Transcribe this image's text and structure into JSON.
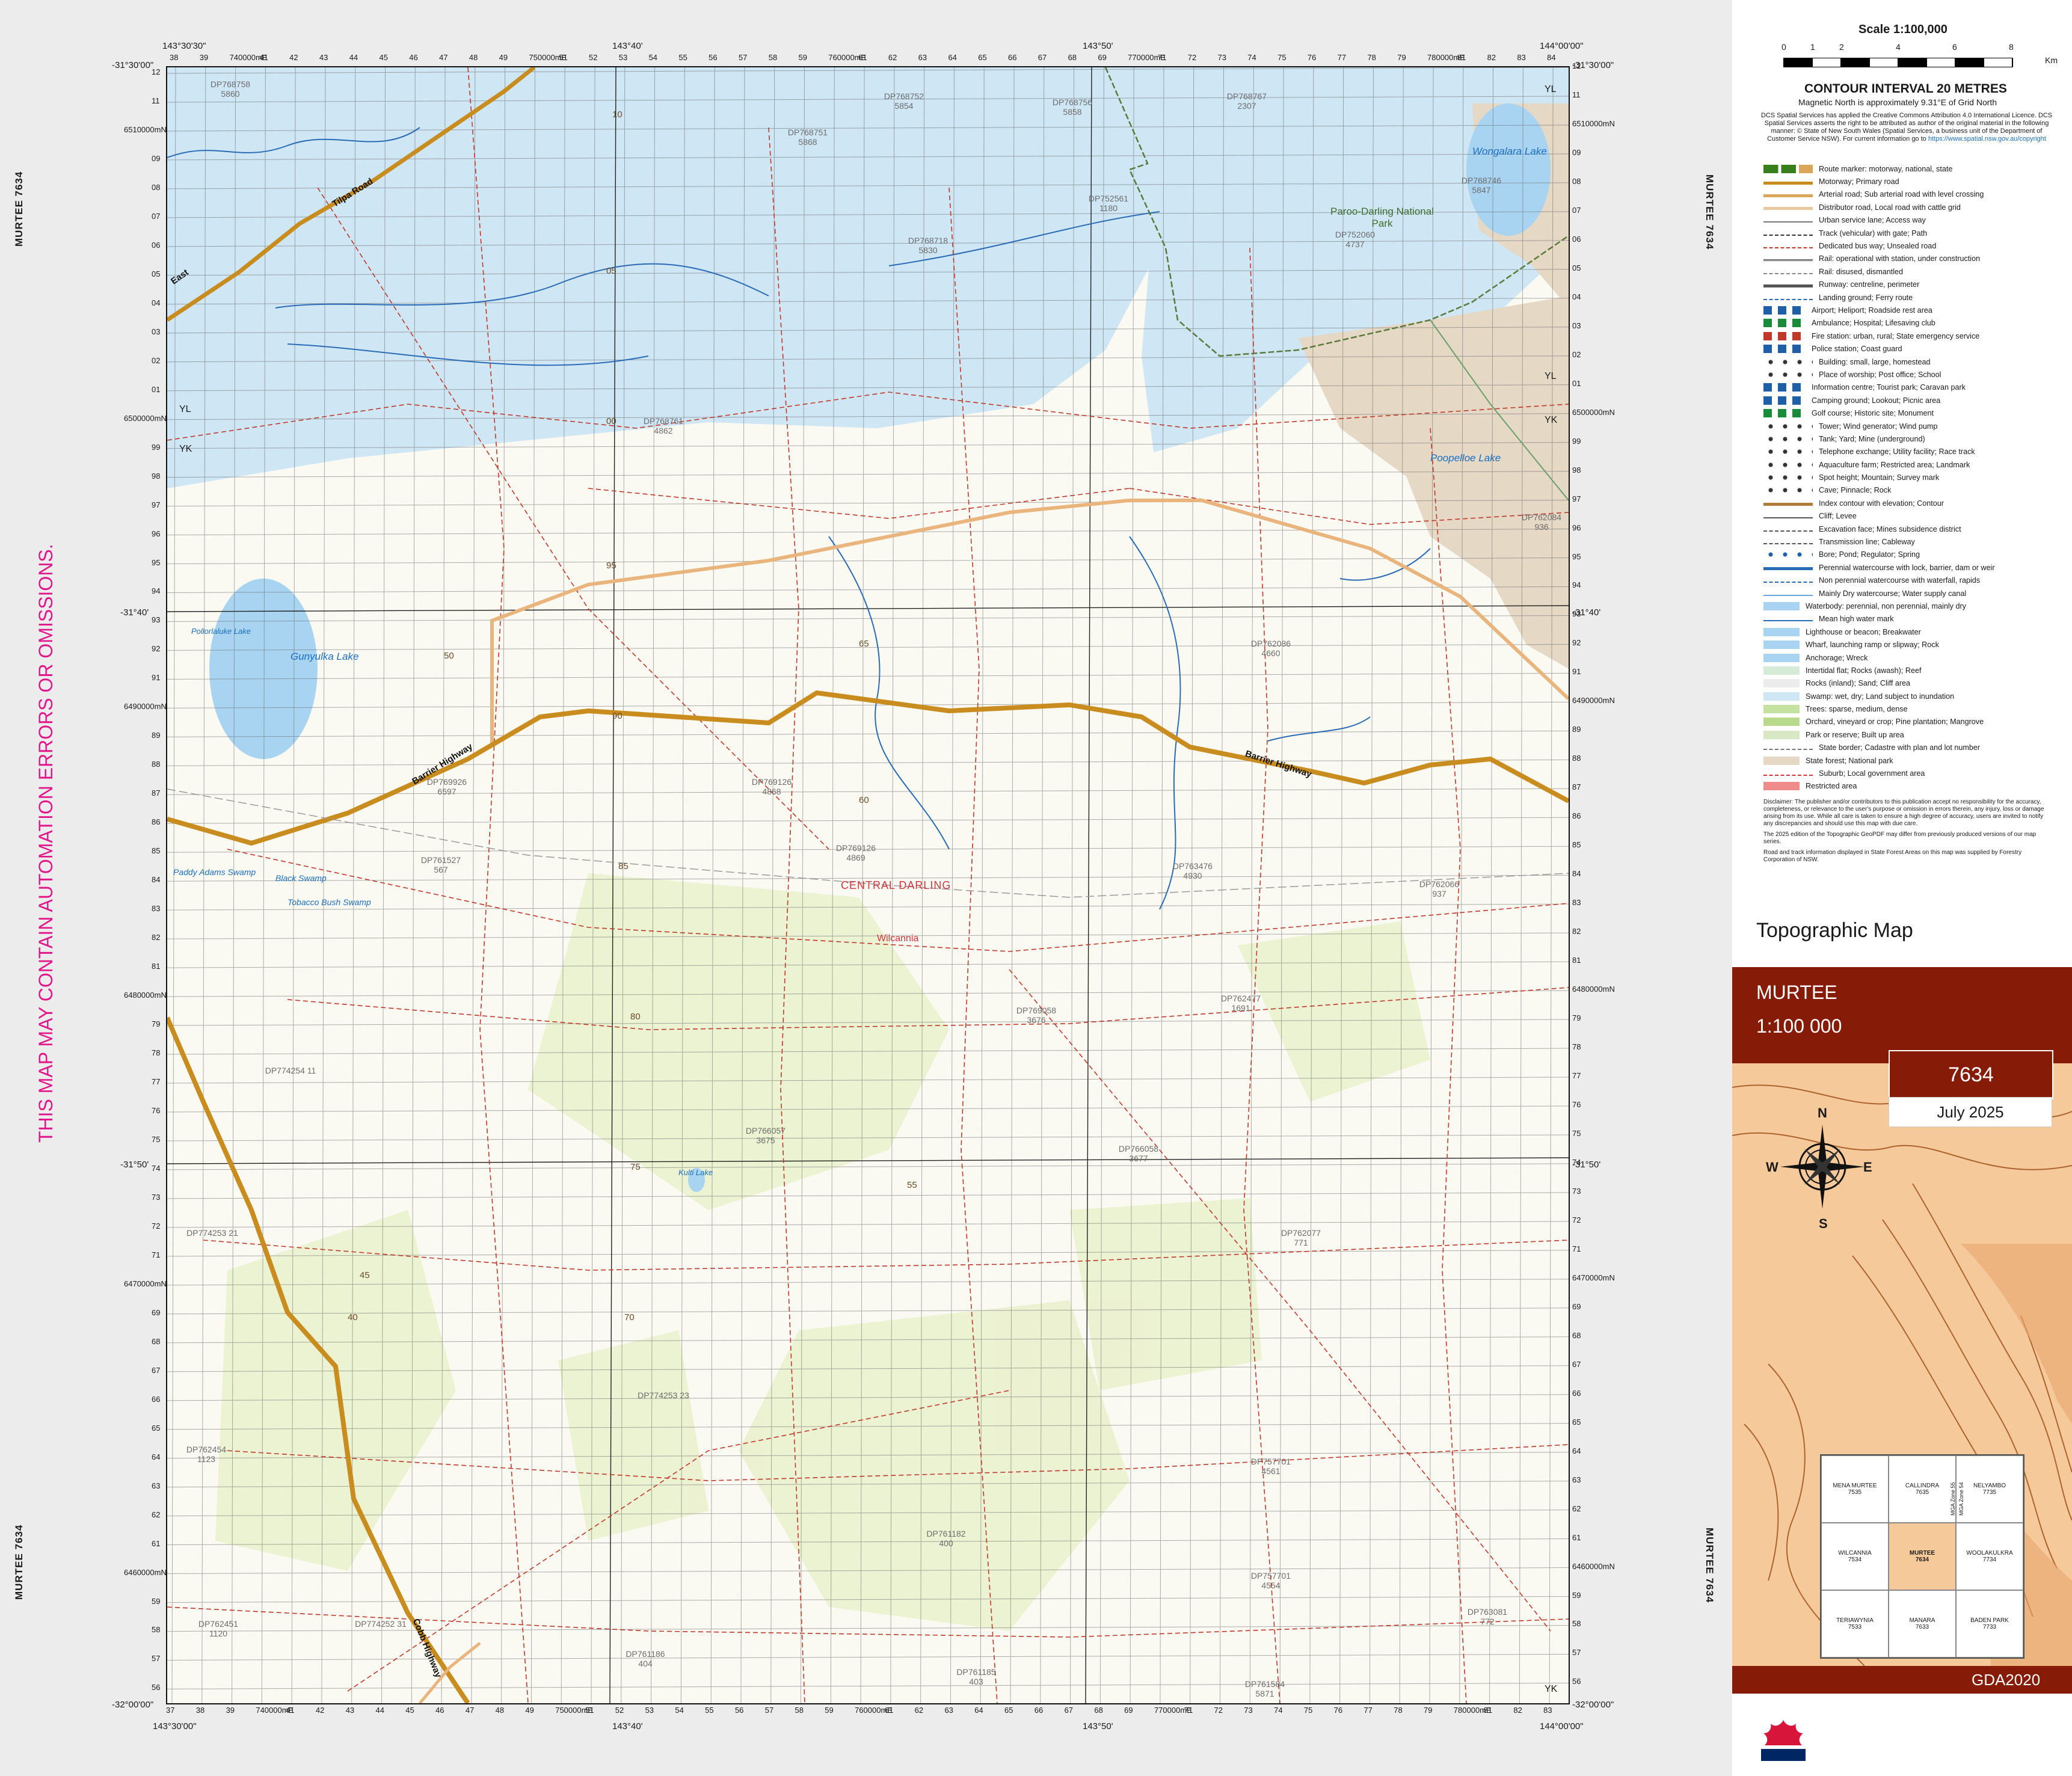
{
  "sheet": {
    "name": "MURTEE",
    "number": "7634",
    "side_label": "MURTEE 7634",
    "scale_text": "1:100 000",
    "date": "July 2025",
    "datum": "GDA2020",
    "product": "Topographic Map"
  },
  "warning": "THIS MAP MAY CONTAIN AUTOMATION ERRORS OR OMISSIONS.",
  "corners": {
    "top_left_lon": "143°30'30\"",
    "top_left_lat": "-31°30'00\"",
    "top_right_lon": "144°00'00\"",
    "top_right_lat": "-31°30'00\"",
    "bottom_left_lon": "143°30'00\"",
    "bottom_left_lat": "-32°00'00\"",
    "bottom_right_lon": "144°00'00\"",
    "bottom_right_lat": "-32°00'00\"",
    "mid_lon_1": "143°40'",
    "mid_lon_2": "143°50'",
    "mid_lat_1": "-31°40'",
    "mid_lat_2": "-31°50'"
  },
  "eastings_top": [
    "38",
    "39",
    "740000mE",
    "41",
    "42",
    "43",
    "44",
    "45",
    "46",
    "47",
    "48",
    "49",
    "750000mE",
    "51",
    "52",
    "53",
    "54",
    "55",
    "56",
    "57",
    "58",
    "59",
    "760000mE",
    "61",
    "62",
    "63",
    "64",
    "65",
    "66",
    "67",
    "68",
    "69",
    "770000mE",
    "71",
    "72",
    "73",
    "74",
    "75",
    "76",
    "77",
    "78",
    "79",
    "780000mE",
    "81",
    "82",
    "83",
    "84"
  ],
  "eastings_bottom": [
    "37",
    "38",
    "39",
    "740000mE",
    "41",
    "42",
    "43",
    "44",
    "45",
    "46",
    "47",
    "48",
    "49",
    "750000mE",
    "51",
    "52",
    "53",
    "54",
    "55",
    "56",
    "57",
    "58",
    "59",
    "760000mE",
    "61",
    "62",
    "63",
    "64",
    "65",
    "66",
    "67",
    "68",
    "69",
    "770000mE",
    "71",
    "72",
    "73",
    "74",
    "75",
    "76",
    "77",
    "78",
    "79",
    "780000mE",
    "81",
    "82",
    "83"
  ],
  "northings": [
    "12",
    "11",
    "6510000mN",
    "09",
    "08",
    "07",
    "06",
    "05",
    "04",
    "03",
    "02",
    "01",
    "6500000mN",
    "99",
    "98",
    "97",
    "96",
    "95",
    "94",
    "93",
    "92",
    "91",
    "6490000mN",
    "89",
    "88",
    "87",
    "86",
    "85",
    "84",
    "83",
    "82",
    "81",
    "6480000mN",
    "79",
    "78",
    "77",
    "76",
    "75",
    "74",
    "73",
    "72",
    "71",
    "6470000mN",
    "69",
    "68",
    "67",
    "66",
    "65",
    "64",
    "63",
    "62",
    "61",
    "6460000mN",
    "59",
    "58",
    "57",
    "56"
  ],
  "map_labels": {
    "lakes": [
      "Gunyulka Lake",
      "Wongalara Lake",
      "Poopelloe Lake",
      "Pollorlaluke Lake",
      "Kulti Lake",
      "Paddy Adams Swamp",
      "Black Swamp",
      "Tobacco Bush Swamp"
    ],
    "park": "Paroo-Darling National Park",
    "region": "CENTRAL DARLING",
    "town": "Wilcannia",
    "roads": [
      "Barrier Highway",
      "Barrier Highway",
      "Tilpa Road",
      "Cobb Highway",
      "East"
    ],
    "zones": [
      "YL",
      "YK",
      "YL",
      "YK",
      "YL",
      "YK",
      "YK"
    ],
    "dp": [
      "DP768758 5860",
      "DP768751 5868",
      "DP768752 5854",
      "DP768756 5858",
      "DP768767 2307",
      "DP752561 1180",
      "DP768718 5830",
      "DP752060 4737",
      "DP768746 5847",
      "DP768761 4862",
      "DP762084 936",
      "DP762086 4660",
      "DP769926 6597",
      "DP761527 567",
      "DP769126 4868",
      "DP769126 4869",
      "DP763476 4930",
      "DP762066 937",
      "DP769058 3676",
      "DP762477 1691",
      "DP774254 11",
      "DP766057 3675",
      "DP766058 3677",
      "DP774253 21",
      "DP762077 771",
      "DP774253 23",
      "DP762454 1123",
      "DP757701 4561",
      "DP761182 400",
      "DP757701 4554",
      "DP774252 31",
      "DP762451 1120",
      "DP761186 404",
      "DP761185 403",
      "DP763081 772",
      "DP761584 5871"
    ],
    "contours": [
      "10",
      "05",
      "00",
      "95",
      "90",
      "85",
      "80",
      "75",
      "70",
      "65",
      "60",
      "55",
      "50",
      "45",
      "40"
    ]
  },
  "legend": {
    "scale_title": "Scale 1:100,000",
    "scale_numbers": [
      "0",
      "1",
      "2",
      "4",
      "6",
      "8"
    ],
    "scale_unit": "Km",
    "contour_interval": "CONTOUR INTERVAL 20 METRES",
    "magnetic_north": "Magnetic North is approximately 9.31°E of Grid North",
    "licence": "DCS Spatial Services has applied the Creative Commons Attribution 4.0 International Licence. DCS Spatial Services asserts the right to be attributed as author of the original material in the following manner: © State of New South Wales (Spatial Services, a business unit of the Department of Customer Service NSW).",
    "licence_link_prefix": "For current information go to",
    "licence_link": "https://www.spatial.nsw.gov.au/copyright",
    "items": [
      {
        "label": "Route marker: motorway, national, state",
        "sym": "marker",
        "color": "#3a7f1e"
      },
      {
        "label": "Motorway; Primary road",
        "sym": "line",
        "color": "#c98c1e"
      },
      {
        "label": "Arterial road; Sub arterial road with level crossing",
        "sym": "line",
        "color": "#d9a65a"
      },
      {
        "label": "Distributor road, Local road with cattle grid",
        "sym": "line",
        "color": "#e9c9a0"
      },
      {
        "label": "Urban service lane; Access way",
        "sym": "thin",
        "color": "#777777"
      },
      {
        "label": "Track (vehicular) with gate; Path",
        "sym": "dash",
        "color": "#333333"
      },
      {
        "label": "Dedicated bus way; Unsealed road",
        "sym": "dash",
        "color": "#c0392b"
      },
      {
        "label": "Rail: operational with station, under construction",
        "sym": "rail",
        "color": "#333333"
      },
      {
        "label": "Rail: disused, dismantled",
        "sym": "dash",
        "color": "#888888"
      },
      {
        "label": "Runway: centreline, perimeter",
        "sym": "line",
        "color": "#555555"
      },
      {
        "label": "Landing ground; Ferry route",
        "sym": "dash",
        "color": "#2a6bb5"
      },
      {
        "label": "Airport; Heliport; Roadside rest area",
        "sym": "icons",
        "color": "#1f5fa8"
      },
      {
        "label": "Ambulance; Hospital; Lifesaving club",
        "sym": "icons",
        "color": "#1a8b3a"
      },
      {
        "label": "Fire station: urban, rural; State emergency service",
        "sym": "icons",
        "color": "#c0392b"
      },
      {
        "label": "Police station; Coast guard",
        "sym": "icons",
        "color": "#1f5fa8"
      },
      {
        "label": "Building: small, large, homestead",
        "sym": "dots",
        "color": "#333333"
      },
      {
        "label": "Place of worship; Post office; School",
        "sym": "dots",
        "color": "#333333"
      },
      {
        "label": "Information centre; Tourist park; Caravan park",
        "sym": "icons",
        "color": "#1f5fa8"
      },
      {
        "label": "Camping ground; Lookout; Picnic area",
        "sym": "icons",
        "color": "#1f5fa8"
      },
      {
        "label": "Golf course; Historic site; Monument",
        "sym": "icons",
        "color": "#1a8b3a"
      },
      {
        "label": "Tower; Wind generator; Wind pump",
        "sym": "dots",
        "color": "#333333"
      },
      {
        "label": "Tank; Yard; Mine (underground)",
        "sym": "dots",
        "color": "#333333"
      },
      {
        "label": "Telephone exchange; Utility facility; Race track",
        "sym": "dots",
        "color": "#333333"
      },
      {
        "label": "Aquaculture farm; Restricted area; Landmark",
        "sym": "dots",
        "color": "#333333"
      },
      {
        "label": "Spot height; Mountain; Survey mark",
        "sym": "dots",
        "color": "#333333"
      },
      {
        "label": "Cave; Pinnacle; Rock",
        "sym": "dots",
        "color": "#333333"
      },
      {
        "label": "Index contour with elevation; Contour",
        "sym": "line",
        "color": "#b07a3a"
      },
      {
        "label": "Cliff; Levee",
        "sym": "thin",
        "color": "#555555"
      },
      {
        "label": "Excavation face; Mines subsidence district",
        "sym": "dash",
        "color": "#555555"
      },
      {
        "label": "Transmission line; Cableway",
        "sym": "dash",
        "color": "#555555"
      },
      {
        "label": "Bore; Pond; Regulator; Spring",
        "sym": "dots",
        "color": "#1f5fa8"
      },
      {
        "label": "Perennial watercourse with lock, barrier, dam or weir",
        "sym": "line",
        "color": "#2a6bb5"
      },
      {
        "label": "Non perennial watercourse with waterfall, rapids",
        "sym": "dash",
        "color": "#2a6bb5"
      },
      {
        "label": "Mainly Dry watercourse; Water supply canal",
        "sym": "thin",
        "color": "#6aa6e0"
      },
      {
        "label": "Waterbody: perennial, non perennial, mainly dry",
        "sym": "fill",
        "color": "#a8d4f2"
      },
      {
        "label": "Mean high water mark",
        "sym": "thin",
        "color": "#2a6bb5"
      },
      {
        "label": "Lighthouse or beacon; Breakwater",
        "sym": "fill",
        "color": "#a8d4f2"
      },
      {
        "label": "Wharf, launching ramp or slipway; Rock",
        "sym": "fill",
        "color": "#a8d4f2"
      },
      {
        "label": "Anchorage; Wreck",
        "sym": "fill",
        "color": "#a8d4f2"
      },
      {
        "label": "Intertidal flat; Rocks (awash); Reef",
        "sym": "fill",
        "color": "#d6ead8"
      },
      {
        "label": "Rocks (inland); Sand; Cliff area",
        "sym": "fill",
        "color": "#ececec"
      },
      {
        "label": "Swamp: wet, dry; Land subject to inundation",
        "sym": "fill",
        "color": "#cfe6f5"
      },
      {
        "label": "Trees: sparse, medium, dense",
        "sym": "fill",
        "color": "#c6e2a0"
      },
      {
        "label": "Orchard, vineyard or crop; Pine plantation; Mangrove",
        "sym": "fill",
        "color": "#b9d98c"
      },
      {
        "label": "Park or reserve; Built up area",
        "sym": "fill",
        "color": "#d8e8c4"
      },
      {
        "label": "State border; Cadastre with plan and lot number",
        "sym": "dash",
        "color": "#777777"
      },
      {
        "label": "State forest; National park",
        "sym": "fill",
        "color": "#e5d8c5"
      },
      {
        "label": "Suburb; Local government area",
        "sym": "dash",
        "color": "#d2353e"
      },
      {
        "label": "Restricted area",
        "sym": "fill",
        "color": "#f08b8b"
      }
    ],
    "disclaimer_1": "Disclaimer: The publisher and/or contributors to this publication accept no responsibility for the accuracy, completeness, or relevance to the user's purpose or omission in errors therein, any injury, loss or damage arising from its use. While all care is taken to ensure a high degree of accuracy, users are invited to notify any discrepancies and should use this map with due care.",
    "disclaimer_2": "The 2025 edition of the Topographic GeoPDF may differ from previously produced versions of our map series.",
    "disclaimer_3": "Road and track information displayed in State Forest Areas on this map was supplied by Forestry Corporation of NSW."
  },
  "compass": {
    "n": "N",
    "s": "S",
    "e": "E",
    "w": "W"
  },
  "index_map": {
    "cells": [
      {
        "name": "MENA MURTEE",
        "num": "7535"
      },
      {
        "name": "CALLINDRA",
        "num": "7635"
      },
      {
        "name": "NELYAMBO",
        "num": "7735"
      },
      {
        "name": "WILCANNIA",
        "num": "7534"
      },
      {
        "name": "MURTEE",
        "num": "7634"
      },
      {
        "name": "WOOLAKULKRA",
        "num": "7734"
      },
      {
        "name": "TERIAWYNIA",
        "num": "7533"
      },
      {
        "name": "MANARA",
        "num": "7633"
      },
      {
        "name": "BADEN PARK",
        "num": "7733"
      }
    ],
    "zone_55": "MGA Zone 55",
    "zone_54": "MGA Zone 54"
  },
  "colors": {
    "water": "#a8d4f2",
    "swamp": "#cfe6f5",
    "park": "#e5d8c5",
    "vegetation": "#e6efc3",
    "highway": "#c98c1e",
    "local_road": "#e9b57d",
    "unsealed": "#c0392b",
    "grid": "#555555",
    "brand_band": "#861c07",
    "warning": "#e0168a"
  }
}
